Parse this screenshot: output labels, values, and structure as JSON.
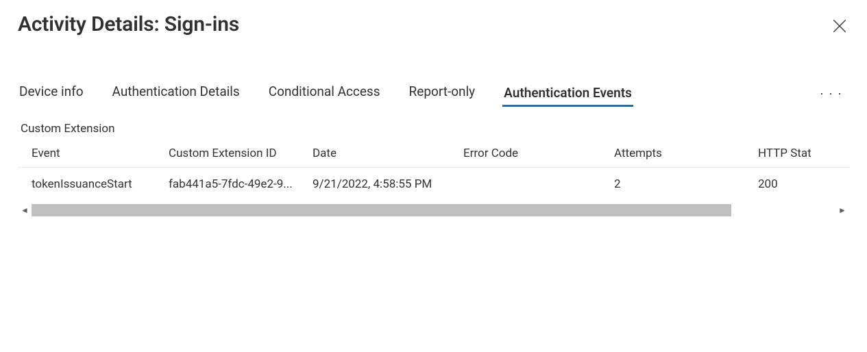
{
  "header": {
    "title": "Activity Details: Sign-ins"
  },
  "tabs": {
    "device_info": "Device info",
    "auth_details": "Authentication Details",
    "conditional_access": "Conditional Access",
    "report_only": "Report-only",
    "auth_events": "Authentication Events"
  },
  "section": {
    "custom_extension": "Custom Extension"
  },
  "columns": {
    "event": "Event",
    "custom_extension_id": "Custom Extension ID",
    "date": "Date",
    "error_code": "Error Code",
    "attempts": "Attempts",
    "http_stat": "HTTP Stat"
  },
  "rows": [
    {
      "event": "tokenIssuanceStart",
      "custom_extension_id": "fab441a5-7fdc-49e2-9...",
      "date": "9/21/2022, 4:58:55 PM",
      "error_code": "",
      "attempts": "2",
      "http_stat": "200"
    }
  ],
  "overflow": {
    "label": "· · ·"
  },
  "scrollbar": {
    "left_arrow": "◄",
    "right_arrow": "►"
  }
}
